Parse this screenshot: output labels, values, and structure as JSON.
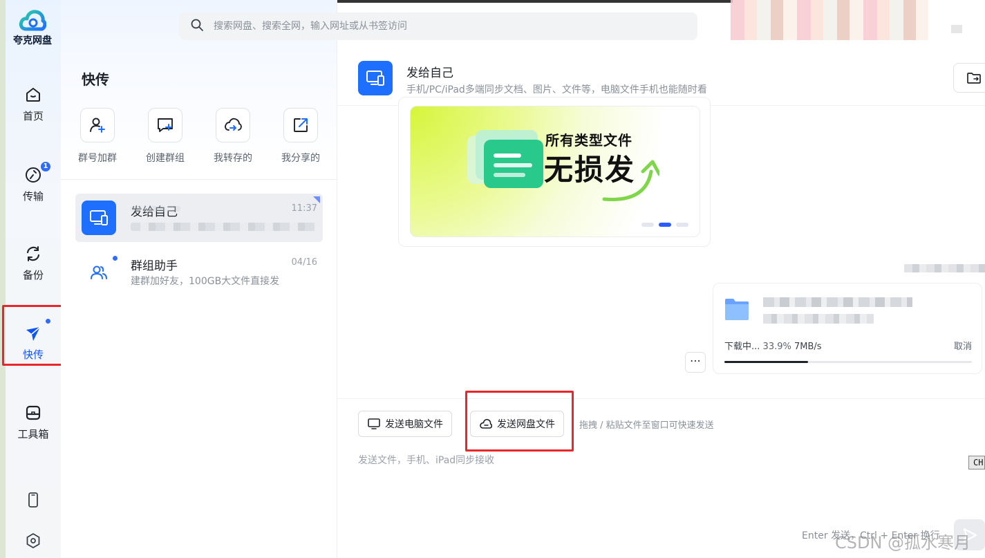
{
  "app": {
    "name": "夸克网盘"
  },
  "rail": {
    "items": [
      {
        "label": "首页"
      },
      {
        "label": "传输",
        "badge": "1"
      },
      {
        "label": "备份"
      },
      {
        "label": "快传"
      },
      {
        "label": "工具箱"
      }
    ]
  },
  "search": {
    "placeholder": "搜索网盘、搜索全网，输入网址或从书签访问"
  },
  "panel": {
    "title": "快传",
    "quick_actions": [
      {
        "label": "群号加群",
        "icon": "user-add-icon"
      },
      {
        "label": "创建群组",
        "icon": "chat-add-icon"
      },
      {
        "label": "我转存的",
        "icon": "cloud-transfer-icon"
      },
      {
        "label": "我分享的",
        "icon": "share-out-icon"
      }
    ],
    "conversations": [
      {
        "name": "发给自己",
        "time": "11:37",
        "selected": true
      },
      {
        "name": "群组助手",
        "time": "04/16",
        "preview": "建群加好友，100GB大文件直接发"
      }
    ]
  },
  "chat": {
    "title": "发给自己",
    "subtitle": "手机/PC/iPad多端同步文档、图片、文件等，电脑文件手机也能随时看",
    "banner": {
      "line1": "所有类型文件",
      "line2": "无损发",
      "active_page": 2,
      "pages": 3
    },
    "download": {
      "status": "下载中...",
      "percent_text": "33.9%",
      "speed": "7MB/s",
      "cancel": "取消",
      "progress": 0.339
    },
    "more": "⋯"
  },
  "composer": {
    "send_pc_file": "发送电脑文件",
    "send_cloud_file": "发送网盘文件",
    "drag_hint": "拖拽 / 粘贴文件至窗口可快速发送",
    "placeholder": "发送文件，手机、iPad同步接收",
    "shortcut": "Enter 发送，Ctrl + Enter 换行",
    "ime": "CH"
  },
  "watermark": "CSDN @孤水寒月",
  "colors": {
    "accent": "#1f6fff",
    "highlight_box": "#e8262c",
    "active_nav": "#0d53ff"
  }
}
